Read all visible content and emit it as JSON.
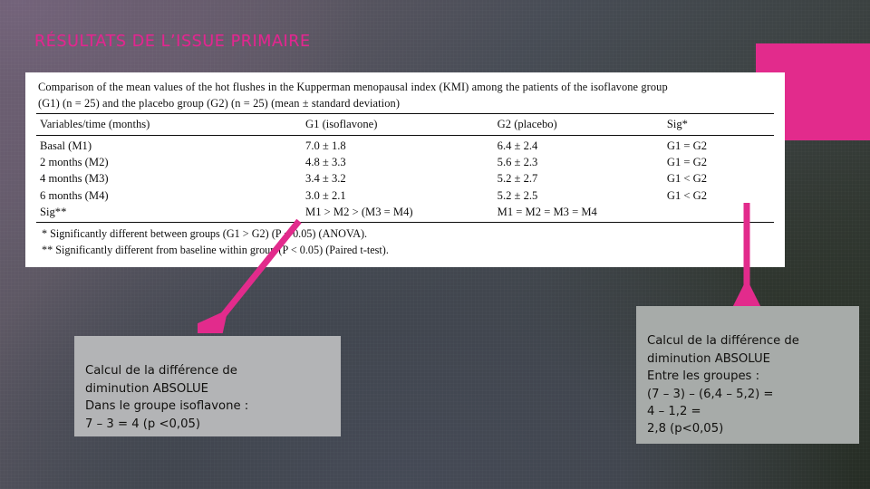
{
  "slide": {
    "title": "RÉSULTATS DE L’ISSUE PRIMAIRE",
    "accent_color": "#e22b8c",
    "title_color": "#e0278f",
    "background_colors": [
      "#6d5f73",
      "#474c55",
      "#2a3129"
    ]
  },
  "table_figure": {
    "caption_line1": "Comparison of the mean values of the hot flushes in the Kupperman menopausal index (KMI) among the patients of the isoflavone group",
    "caption_line2": "(G1) (n = 25) and the placebo group (G2) (n = 25) (mean ± standard deviation)",
    "headers": [
      "Variables/time (months)",
      "G1 (isoflavone)",
      "G2 (placebo)",
      "Sig*"
    ],
    "rows": [
      {
        "variable": "Basal (M1)",
        "g1": "7.0 ± 1.8",
        "g2": "6.4 ± 2.4",
        "sig": "G1 = G2",
        "sig_bold": false
      },
      {
        "variable": "2 months (M2)",
        "g1": "4.8 ± 3.3",
        "g2": "5.6 ± 2.3",
        "sig": "G1 = G2",
        "sig_bold": false
      },
      {
        "variable": "4 months (M3)",
        "g1": "3.4 ± 3.2",
        "g2": "5.2 ± 2.7",
        "sig": "G1 < G2",
        "sig_bold": true
      },
      {
        "variable": "6 months (M4)",
        "g1": "3.0 ± 2.1",
        "g2": "5.2 ± 2.5",
        "sig": "G1 < G2",
        "sig_bold": true
      },
      {
        "variable": "Sig**",
        "g1": "M1 > M2 > (M3 = M4)",
        "g2": "M1 = M2 = M3 = M4",
        "sig": "",
        "sig_bold": false
      }
    ],
    "footnote1": "* Significantly different between groups (G1 > G2) (P < 0.05) (ANOVA).",
    "footnote2": "** Significantly different from baseline within group (P < 0.05) (Paired t-test)."
  },
  "callout_left": {
    "text": "Calcul de la différence de\ndiminution ABSOLUE\nDans le groupe isoflavone :\n7 – 3 = 4 (p <0,05)"
  },
  "callout_right": {
    "text": "Calcul de la différence de\ndiminution ABSOLUE\nEntre les groupes :\n(7 – 3) – (6,4 – 5,2) =\n4 – 1,2 =\n2,8 (p<0,05)"
  },
  "arrows": {
    "left_label": "arrow-to-left-callout",
    "right_label": "arrow-to-right-callout",
    "color": "#e22b8c"
  }
}
